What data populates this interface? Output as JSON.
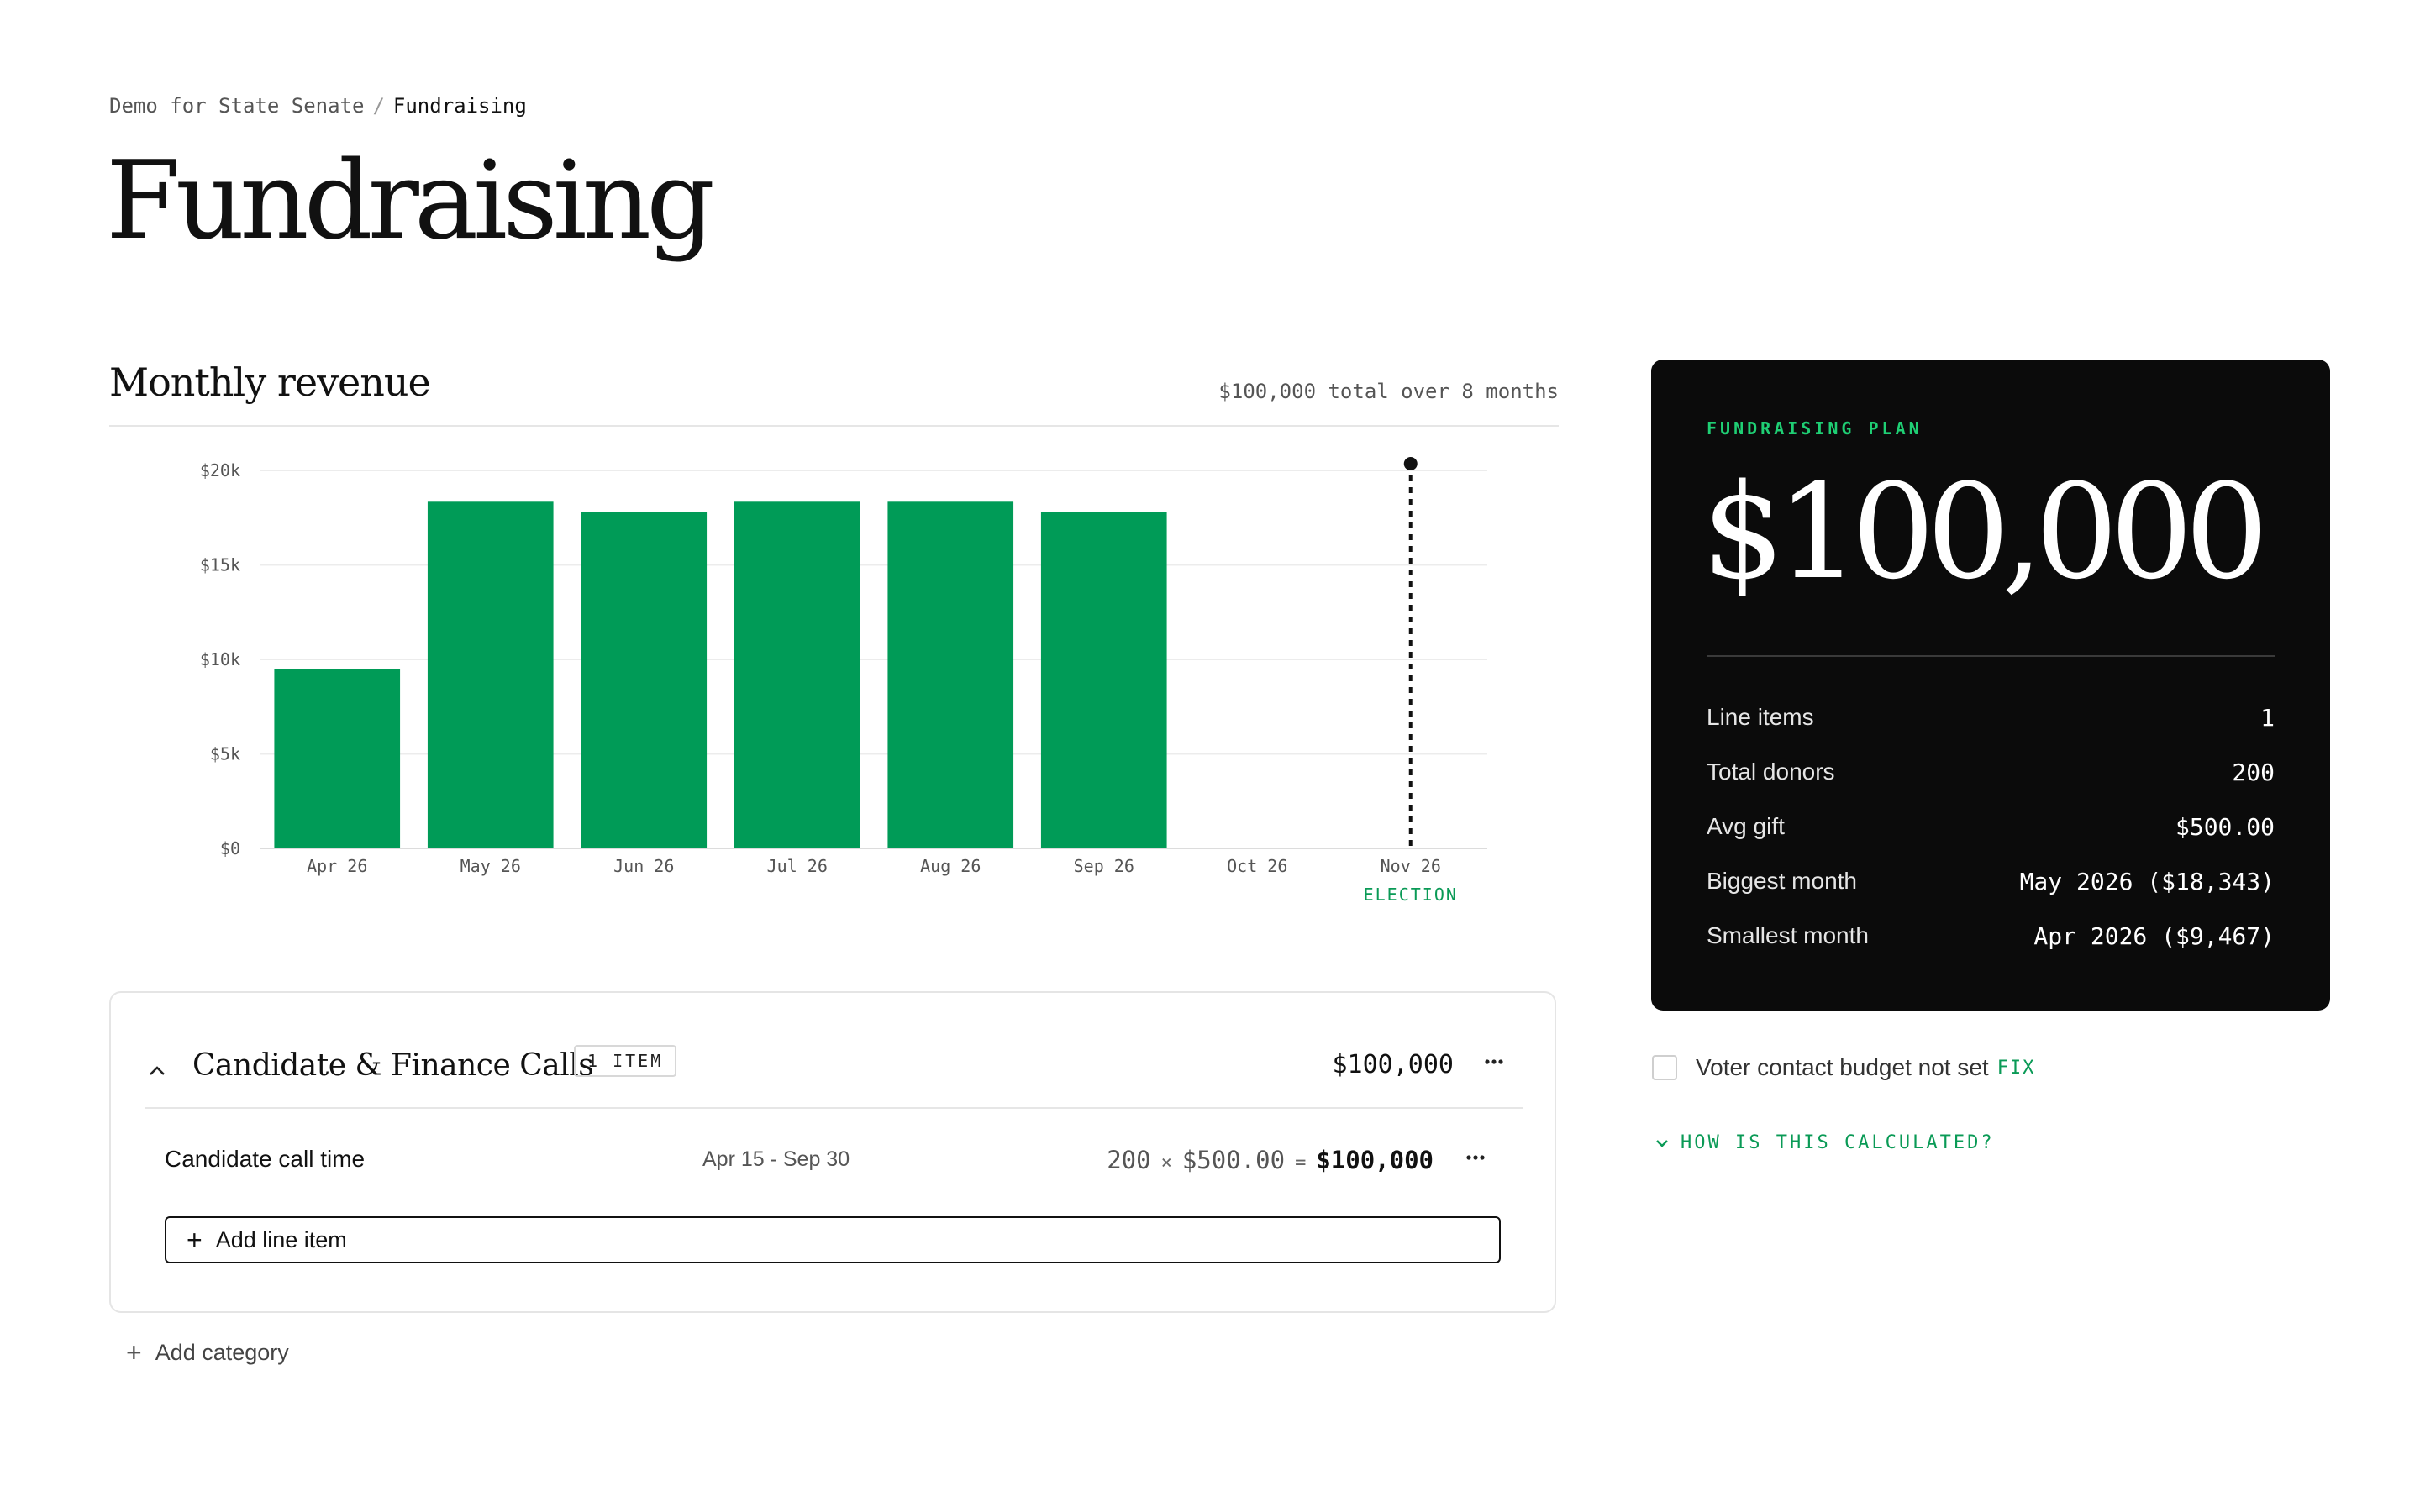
{
  "breadcrumb": {
    "parent": "Demo for State Senate",
    "separator": "/",
    "current": "Fundraising"
  },
  "page": {
    "title": "Fundraising"
  },
  "revenue": {
    "title": "Monthly revenue",
    "summary": "$100,000 total over 8 months"
  },
  "chart_data": {
    "type": "bar",
    "categories": [
      "Apr 26",
      "May 26",
      "Jun 26",
      "Jul 26",
      "Aug 26",
      "Sep 26",
      "Oct 26",
      "Nov 26"
    ],
    "values": [
      9467,
      18343,
      17800,
      18343,
      18343,
      17800,
      0,
      0
    ],
    "yticks": [
      0,
      5000,
      10000,
      15000,
      20000
    ],
    "ytick_labels": [
      "$0",
      "$5k",
      "$10k",
      "$15k",
      "$20k"
    ],
    "ylim": [
      0,
      20000
    ],
    "grid": true,
    "bar_color": "#009b57",
    "marker": {
      "category": "Nov 26",
      "label": "ELECTION",
      "color": "#0a9a56"
    }
  },
  "category": {
    "title": "Candidate & Finance Calls",
    "badge": "1 ITEM",
    "amount": "$100,000",
    "more_icon": "ellipsis-icon",
    "collapse_icon": "chevron-up-icon",
    "line_items": [
      {
        "name": "Candidate call time",
        "dates": "Apr 15 - Sep 30",
        "donors": "200",
        "times": "×",
        "gift": "$500.00",
        "equals": "=",
        "total": "$100,000"
      }
    ],
    "add_line_label": "Add line item"
  },
  "add_category_label": "Add category",
  "plan": {
    "label": "FUNDRAISING PLAN",
    "amount": "$100,000",
    "stats": [
      {
        "label": "Line items",
        "value": "1"
      },
      {
        "label": "Total donors",
        "value": "200"
      },
      {
        "label": "Avg gift",
        "value": "$500.00"
      },
      {
        "label": "Biggest month",
        "value": "May 2026 ($18,343)"
      },
      {
        "label": "Smallest month",
        "value": "Apr 2026 ($9,467)"
      }
    ]
  },
  "warning": {
    "text": "Voter contact budget not set",
    "fix": "FIX"
  },
  "calc_link": {
    "label": "HOW IS THIS CALCULATED?",
    "icon": "chevron-down-icon"
  },
  "colors": {
    "accent_green": "#009b57",
    "plan_bg": "#0b0b0b",
    "plan_label": "#1fcf74"
  }
}
